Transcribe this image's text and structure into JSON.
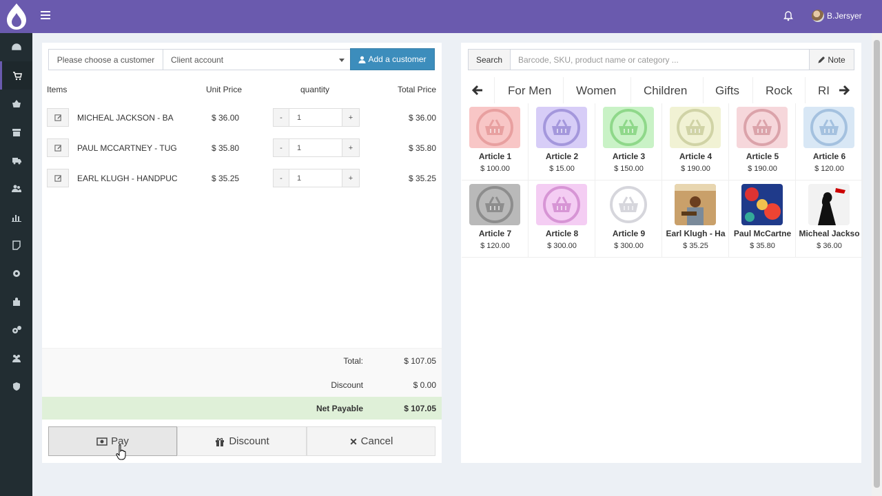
{
  "header": {
    "user_name": "B.Jersyer"
  },
  "customer": {
    "label": "Please choose a customer",
    "selected": "Client account",
    "add_label": "Add a customer"
  },
  "cart": {
    "headers": {
      "items": "Items",
      "unit_price": "Unit Price",
      "quantity": "quantity",
      "total_price": "Total Price"
    },
    "rows": [
      {
        "name": "MICHEAL JACKSON - BA",
        "price": "$ 36.00",
        "qty": "1",
        "total": "$ 36.00",
        "minus": "-",
        "plus": "+"
      },
      {
        "name": "PAUL MCCARTNEY - TUG",
        "price": "$ 35.80",
        "qty": "1",
        "total": "$ 35.80",
        "minus": "-",
        "plus": "+"
      },
      {
        "name": "EARL KLUGH - HANDPUC",
        "price": "$ 35.25",
        "qty": "1",
        "total": "$ 35.25",
        "minus": "-",
        "plus": "+"
      }
    ],
    "total_label": "Total:",
    "total_value": "$ 107.05",
    "discount_label": "Discount",
    "discount_value": "$ 0.00",
    "net_label": "Net Payable",
    "net_value": "$ 107.05"
  },
  "actions": {
    "pay": "Pay",
    "discount": "Discount",
    "cancel": "Cancel"
  },
  "search": {
    "label": "Search",
    "placeholder": "Barcode, SKU, product name or category ...",
    "note_label": "Note"
  },
  "categories": [
    "For Men",
    "Women",
    "Children",
    "Gifts",
    "Rock",
    "RI"
  ],
  "products": [
    {
      "name": "Article 1",
      "price": "$ 100.00",
      "bg": "#f8c6c6",
      "fg": "#e8a0a0"
    },
    {
      "name": "Article 2",
      "price": "$ 15.00",
      "bg": "#d7cdf7",
      "fg": "#a497dc"
    },
    {
      "name": "Article 3",
      "price": "$ 150.00",
      "bg": "#c9f2c6",
      "fg": "#8fd88a"
    },
    {
      "name": "Article 4",
      "price": "$ 190.00",
      "bg": "#f1f2d4",
      "fg": "#d0d3a6"
    },
    {
      "name": "Article 5",
      "price": "$ 190.00",
      "bg": "#f6d7db",
      "fg": "#dba3aa"
    },
    {
      "name": "Article 6",
      "price": "$ 120.00",
      "bg": "#d8e7f5",
      "fg": "#a4c1df"
    },
    {
      "name": "Article 7",
      "price": "$ 120.00",
      "bg": "#b9b9b9",
      "fg": "#8d8d8d"
    },
    {
      "name": "Article 8",
      "price": "$ 300.00",
      "bg": "#f4cdf3",
      "fg": "#d795d5"
    },
    {
      "name": "Article 9",
      "price": "$ 300.00",
      "bg": "#ffffff",
      "fg": "#d6d6dc"
    },
    {
      "name": "Earl Klugh - Ha",
      "price": "$ 35.25",
      "cover": "earl"
    },
    {
      "name": "Paul McCartne",
      "price": "$ 35.80",
      "cover": "paul"
    },
    {
      "name": "Micheal Jackso",
      "price": "$ 36.00",
      "cover": "mj"
    }
  ],
  "colors": {
    "primary": "#6a5aae",
    "sidebar": "#222d32",
    "add_button": "#3c8dbc",
    "net_row": "#dff0d8"
  }
}
